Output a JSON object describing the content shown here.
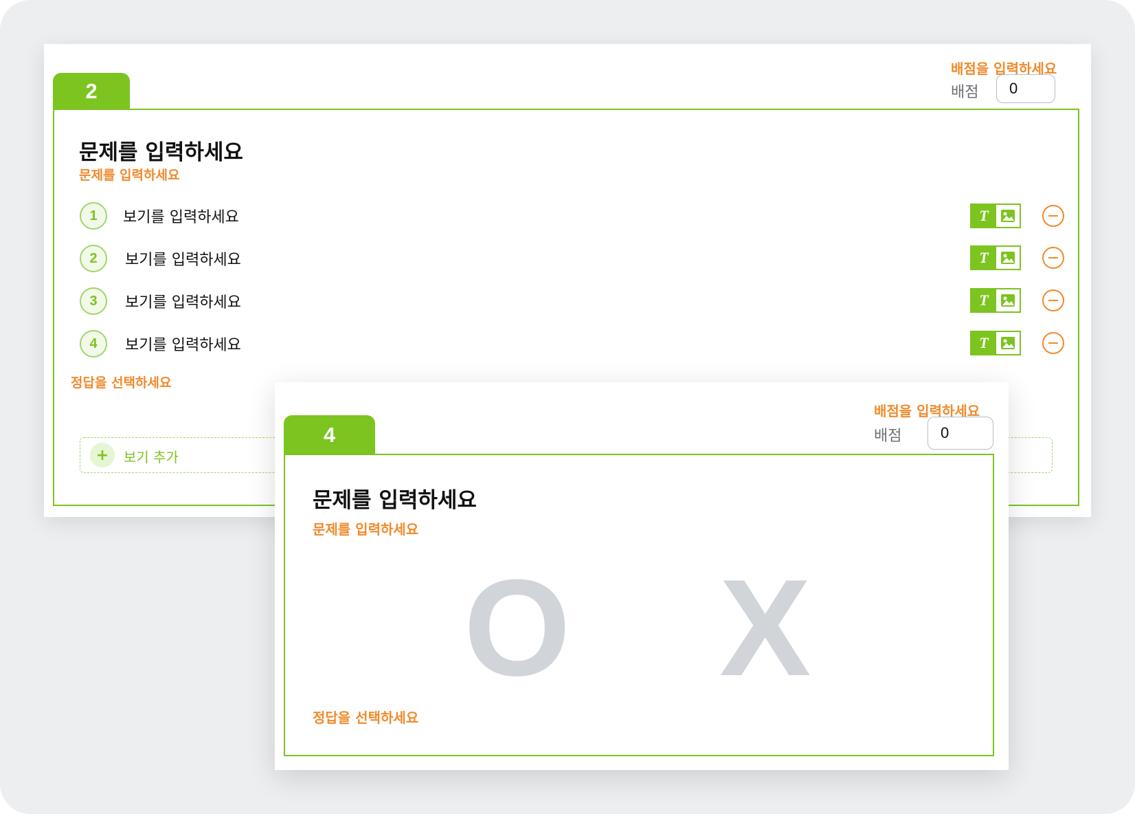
{
  "colors": {
    "accent": "#7cc41f",
    "hint": "#f08a2c",
    "muted": "#d1d5da",
    "background": "#eceef0"
  },
  "question_multiple": {
    "number": "2",
    "score_hint": "배점을 입력하세요",
    "score_label": "배점",
    "score_value": "0",
    "title": "문제를 입력하세요",
    "title_hint": "문제를 입력하세요",
    "options": [
      {
        "number": "1",
        "text": "보기를 입력하세요"
      },
      {
        "number": "2",
        "text": "보기를 입력하세요"
      },
      {
        "number": "3",
        "text": "보기를 입력하세요"
      },
      {
        "number": "4",
        "text": "보기를 입력하세요"
      }
    ],
    "option_toggle_text": "T",
    "answer_hint": "정답을 선택하세요",
    "add_option_icon": "+",
    "add_option_label": "보기 추가"
  },
  "question_ox": {
    "number": "4",
    "score_hint": "배점을 입력하세요",
    "score_label": "배점",
    "score_value": "0",
    "title": "문제를 입력하세요",
    "title_hint": "문제를 입력하세요",
    "choice_o": "O",
    "choice_x": "X",
    "answer_hint": "정답을 선택하세요"
  }
}
